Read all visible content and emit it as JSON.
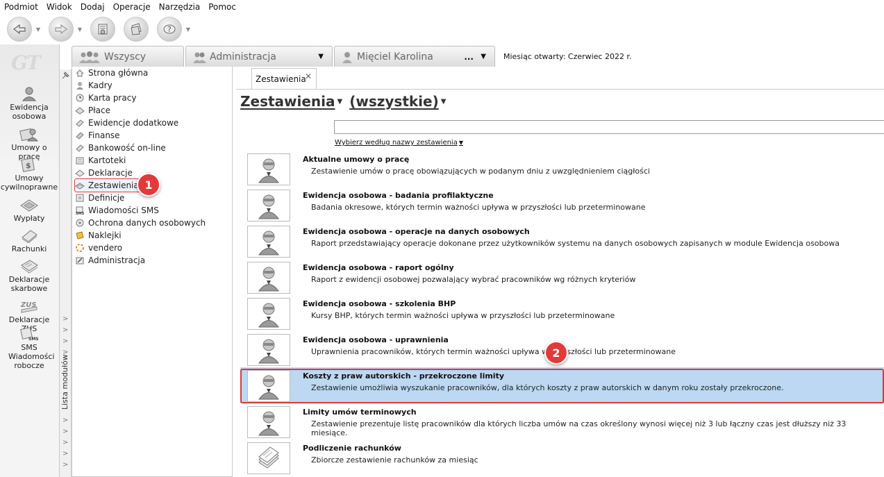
{
  "menu": [
    "Podmiot",
    "Widok",
    "Dodaj",
    "Operacje",
    "Narzędzia",
    "Pomoc"
  ],
  "toolbar": {
    "buttons": [
      {
        "icon": "back-arrow-icon",
        "has_dropdown": true
      },
      {
        "icon": "forward-arrow-icon",
        "has_dropdown": true
      },
      {
        "icon": "document-stamp-icon",
        "has_dropdown": false
      },
      {
        "icon": "papers-icon",
        "has_dropdown": false
      },
      {
        "icon": "help-icon",
        "has_dropdown": true
      }
    ]
  },
  "left_nav": [
    {
      "label": "Ewidencja osobowa",
      "icon": "person-icon"
    },
    {
      "label": "Umowy o pracę",
      "icon": "person-contract-icon"
    },
    {
      "label": "Umowy cywilnoprawne",
      "icon": "civil-contract-icon"
    },
    {
      "label": "Wypłaty",
      "icon": "payout-icon"
    },
    {
      "label": "Rachunki",
      "icon": "bills-icon"
    },
    {
      "label": "Deklaracje skarbowe",
      "icon": "tax-declaration-icon"
    },
    {
      "label": "Deklaracje ZUS",
      "icon": "zus-icon"
    },
    {
      "label": "SMS Wiadomości robocze",
      "icon": "sms-icon"
    }
  ],
  "module_strip_label": "Lista modułów",
  "context_tabs": {
    "all": "Wszyscy",
    "department": "Administracja",
    "employee": "Mięciel Karolina",
    "employee_more": "..."
  },
  "month_label": "Miesiąc otwarty: Czerwiec 2022 r.",
  "tree": [
    "Strona główna",
    "Kadry",
    "Karta pracy",
    "Płace",
    "Ewidencje dodatkowe",
    "Finanse",
    "Bankowość on-line",
    "Kartoteki",
    "Deklaracje",
    "Zestawienia",
    "Definicje",
    "Wiadomości SMS",
    "Ochrona danych osobowych",
    "Naklejki",
    "vendero",
    "Administracja"
  ],
  "tree_selected": "Zestawienia",
  "badges": {
    "one": "1",
    "two": "2"
  },
  "doc_tab": "Zestawienia",
  "heading": {
    "title": "Zestawienia",
    "filter": "(wszystkie)"
  },
  "search": {
    "value": "",
    "hint": "Wybierz według nazwy zestawienia"
  },
  "reports": [
    {
      "title": "Aktualne umowy o pracę",
      "desc": "Zestawienie umów o pracę obowiązujących w podanym dniu z uwzględnieniem ciągłości"
    },
    {
      "title": "Ewidencja osobowa - badania profilaktyczne",
      "desc": "Badania okresowe, których termin ważności upływa w przyszłości lub przeterminowane"
    },
    {
      "title": "Ewidencja osobowa - operacje na danych osobowych",
      "desc": "Raport przedstawiający operacje dokonane przez użytkowników systemu na danych osobowych zapisanych w module Ewidencja osobowa"
    },
    {
      "title": "Ewidencja osobowa - raport ogólny",
      "desc": "Raport z ewidencji osobowej pozwalający wybrać pracowników wg różnych kryteriów"
    },
    {
      "title": "Ewidencja osobowa - szkolenia BHP",
      "desc": "Kursy BHP, których termin ważności upływa w przyszłości lub przeterminowane"
    },
    {
      "title": "Ewidencja osobowa - uprawnienia",
      "desc": "Uprawnienia pracowników, których termin ważności upływa w przyszłości lub przeterminowane"
    },
    {
      "title": "Koszty z praw autorskich - przekroczone limity",
      "desc": "Zestawienie umożliwia wyszukanie pracowników, dla których koszty z praw autorskich w danym roku zostały przekroczone."
    },
    {
      "title": "Limity umów terminowych",
      "desc": "Zestawienie prezentuje listę pracowników dla których liczba umów na czas określony wynosi więcej niż 3 lub łączny czas jest dłuższy niż 33 miesiące."
    },
    {
      "title": "Podliczenie rachunków",
      "desc": "Zbiorcze zestawienie rachunków za miesiąc"
    }
  ],
  "reports_selected": "Koszty z praw autorskich - przekroczone limity",
  "colors": {
    "selection": "#bcd8f2",
    "highlight": "#e23a3a"
  }
}
